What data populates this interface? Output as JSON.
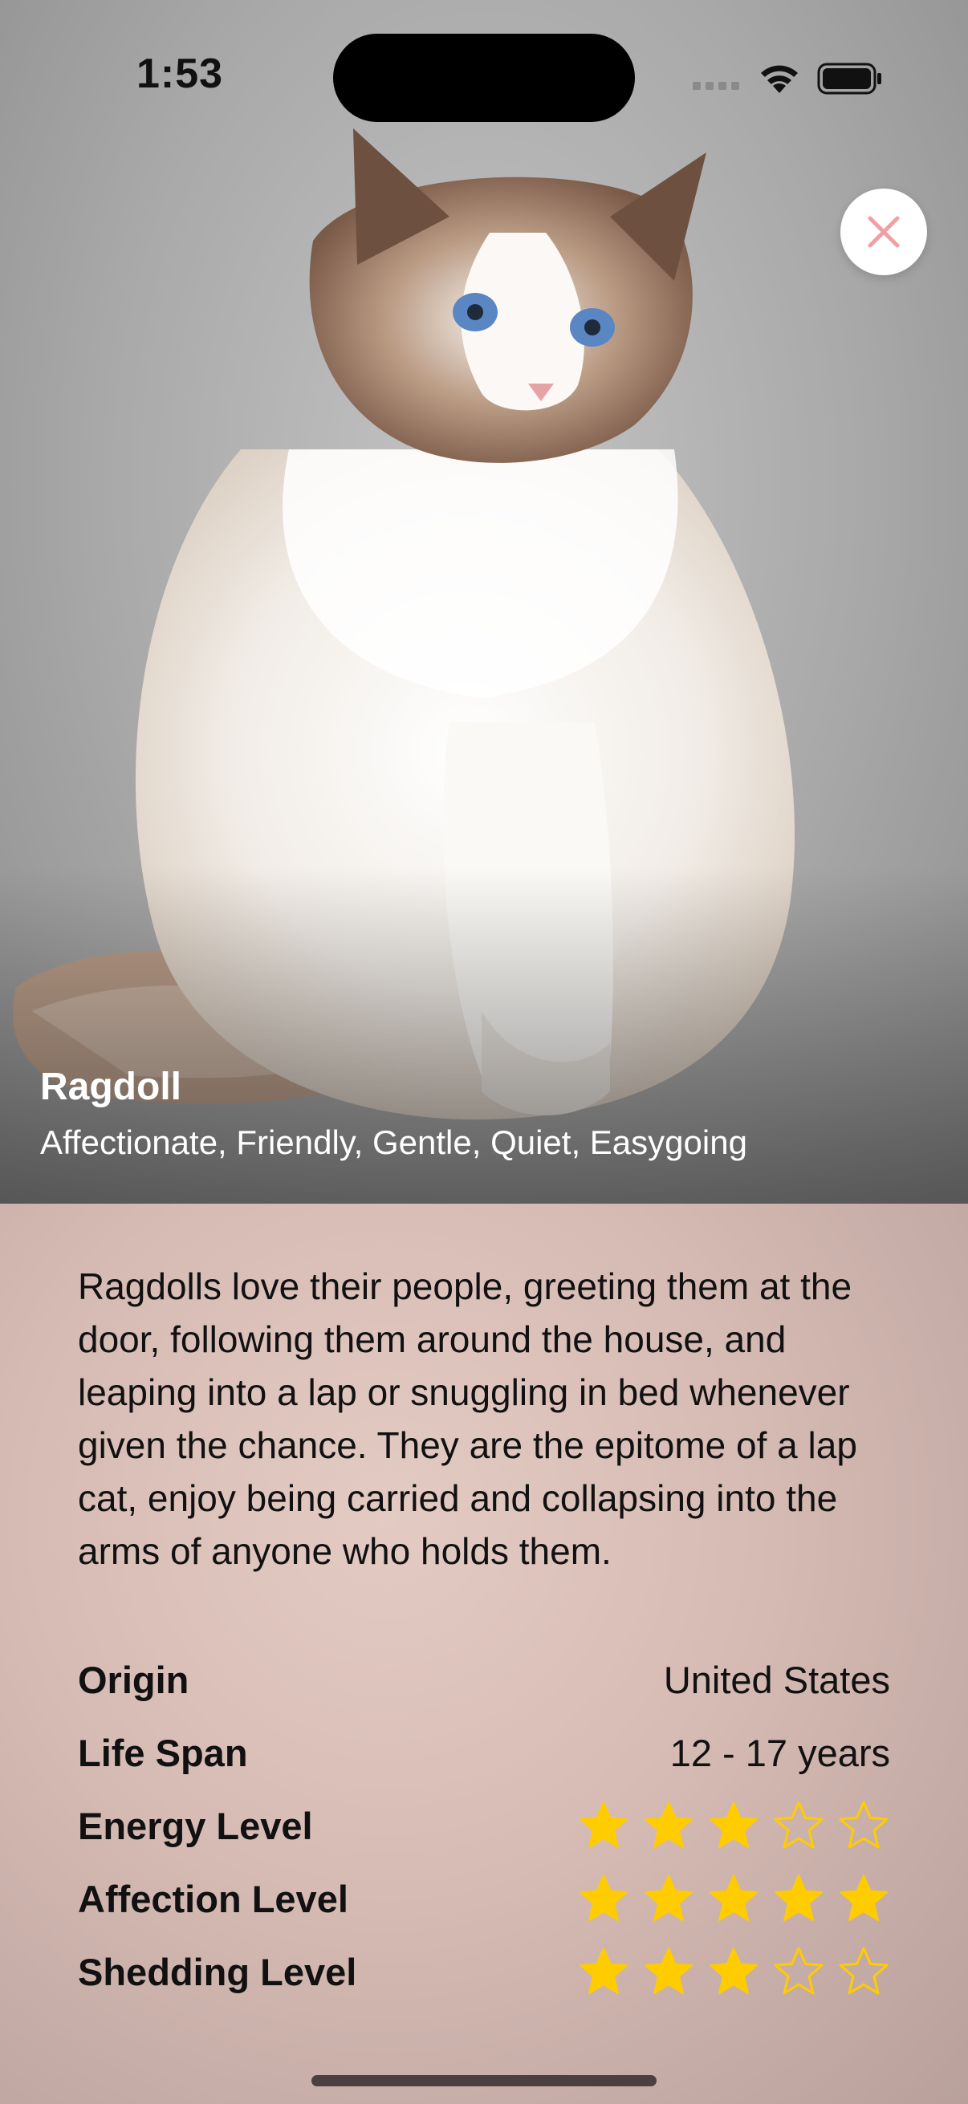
{
  "status_bar": {
    "time": "1:53"
  },
  "breed": {
    "name": "Ragdoll",
    "temperament": "Affectionate, Friendly, Gentle, Quiet, Easygoing",
    "description": "Ragdolls love their people, greeting them at the door, following them around the house, and leaping into a lap or snuggling in bed whenever given the chance. They are the epitome of a lap cat, enjoy being carried and collapsing into the arms of anyone who holds them."
  },
  "attributes": {
    "origin": {
      "label": "Origin",
      "value": "United States"
    },
    "life_span": {
      "label": "Life Span",
      "value": "12 - 17 years"
    },
    "energy": {
      "label": "Energy Level",
      "rating": 3,
      "max": 5
    },
    "affection": {
      "label": "Affection Level",
      "rating": 5,
      "max": 5
    },
    "shedding": {
      "label": "Shedding Level",
      "rating": 3,
      "max": 5
    }
  },
  "icons": {
    "close": "close-icon",
    "star_filled": "star-filled-icon",
    "star_empty": "star-outline-icon"
  },
  "colors": {
    "star": "#FFCC00",
    "close_icon": "#F0A0A4"
  }
}
